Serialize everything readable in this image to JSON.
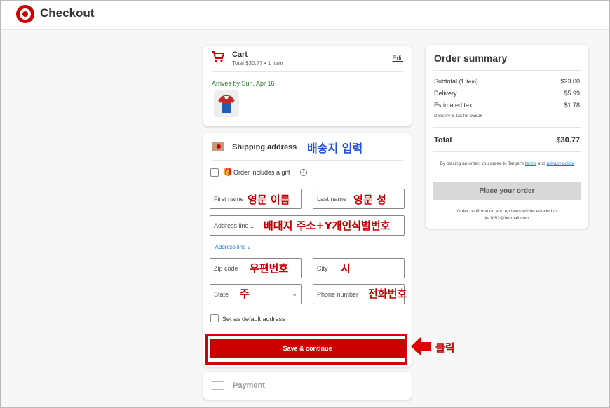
{
  "header": {
    "title": "Checkout"
  },
  "cart": {
    "title": "Cart",
    "subtitle": "Total $30.77 • 1 item",
    "edit": "Edit",
    "arrives": "Arrives by Sun, Apr 16"
  },
  "shipping": {
    "title": "Shipping address",
    "gift_label": "Order includes a gift",
    "first_name": "First name",
    "last_name": "Last name",
    "address1": "Address line 1",
    "address2_link": "+ Address line 2",
    "zip": "Zip code",
    "city": "City",
    "state": "State",
    "phone": "Phone number",
    "default_label": "Set as default address",
    "save_button": "Save & continue"
  },
  "payment": {
    "title": "Payment"
  },
  "summary": {
    "title": "Order summary",
    "subtotal_label": "Subtotal",
    "subtotal_items": "(1 item)",
    "subtotal_value": "$23.00",
    "delivery_label": "Delivery",
    "delivery_value": "$5.99",
    "tax_label": "Estimated tax",
    "tax_value": "$1.78",
    "tax_note": "Delivery & tax for 95826",
    "total_label": "Total",
    "total_value": "$30.77",
    "terms_prefix": "By placing an order, you agree to Target's",
    "terms_link": "terms",
    "terms_and": "and",
    "privacy_link": "privacy policy",
    "place_order": "Place your order",
    "confirm_line1": "Order confirmation and updates will be emailed to",
    "confirm_email": "ka1052@hotmail.com"
  },
  "annotations": {
    "shipping": "배송지 입력",
    "first_name": "영문 이름",
    "last_name": "영문 성",
    "address": "배대지 주소+Y개인식별번호",
    "zip": "우편번호",
    "city": "시",
    "state": "주",
    "phone": "전화번호",
    "click": "클릭"
  },
  "colors": {
    "brand": "#cc0000",
    "annotation_red": "#c00000",
    "annotation_blue": "#1e4fd8",
    "delivery_green": "#2e7d32"
  }
}
